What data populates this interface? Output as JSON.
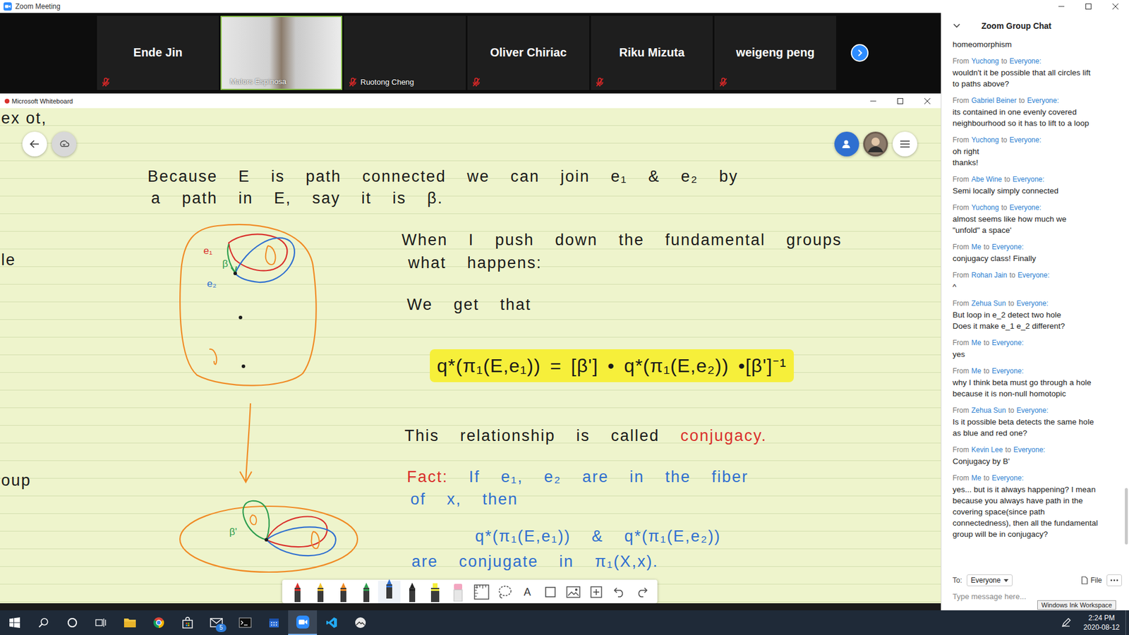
{
  "zoom": {
    "title": "Zoom Meeting"
  },
  "participants": [
    {
      "name": "Ende Jin",
      "kind": "name",
      "muted": true,
      "speaking": false
    },
    {
      "name": "Malors Espinosa",
      "kind": "video",
      "muted": false,
      "speaking": true
    },
    {
      "name": "Ruotong Cheng",
      "kind": "blank",
      "muted": true,
      "speaking": false
    },
    {
      "name": "Oliver Chiriac",
      "kind": "name",
      "muted": true,
      "speaking": false
    },
    {
      "name": "Riku Mizuta",
      "kind": "name",
      "muted": true,
      "speaking": false
    },
    {
      "name": "weigeng peng",
      "kind": "name",
      "muted": true,
      "speaking": false
    }
  ],
  "whiteboard": {
    "title": "Microsoft Whiteboard",
    "edge_fragments": [
      "ex ot,",
      "le",
      "oup"
    ],
    "notes": [
      {
        "highlighted": false,
        "spans": [
          {
            "text": "Because E is path connected we can join e₁ & e₂ by",
            "color": "#1a1a1a"
          }
        ]
      },
      {
        "highlighted": false,
        "spans": [
          {
            "text": "a path in E, say it is β.",
            "color": "#1a1a1a"
          }
        ]
      },
      {
        "highlighted": false,
        "spans": [
          {
            "text": "When I push down the fundamental groups",
            "color": "#1a1a1a"
          }
        ]
      },
      {
        "highlighted": false,
        "spans": [
          {
            "text": "what happens:",
            "color": "#1a1a1a"
          }
        ]
      },
      {
        "highlighted": false,
        "spans": [
          {
            "text": "We get that",
            "color": "#1a1a1a"
          }
        ]
      },
      {
        "highlighted": true,
        "spans": [
          {
            "text": "q*(π₁(E,e₁)) = [β'] • q*(π₁(E,e₂)) •[β']⁻¹",
            "color": "#1a1a1a"
          }
        ]
      },
      {
        "highlighted": false,
        "spans": [
          {
            "text": "This relationship is called ",
            "color": "#1a1a1a"
          },
          {
            "text": "conjugacy.",
            "color": "#d9302c"
          }
        ]
      },
      {
        "highlighted": false,
        "spans": [
          {
            "text": "Fact:",
            "color": "#d9302c"
          },
          {
            "text": " If e₁, e₂ are in the fiber",
            "color": "#2f6fd0"
          }
        ]
      },
      {
        "highlighted": false,
        "spans": [
          {
            "text": "of x, then",
            "color": "#2f6fd0"
          }
        ]
      },
      {
        "highlighted": false,
        "spans": [
          {
            "text": "q*(π₁(E,e₁)) & q*(π₁(E,e₂))",
            "color": "#2f6fd0"
          }
        ]
      },
      {
        "highlighted": false,
        "spans": [
          {
            "text": "are conjugate in π₁(X,x).",
            "color": "#2f6fd0"
          }
        ]
      }
    ],
    "diagram": {
      "labels": [
        {
          "text": "e₁",
          "color": "#d9302c"
        },
        {
          "text": "β",
          "color": "#2e9e4f"
        },
        {
          "text": "e₂",
          "color": "#2f6fd0"
        },
        {
          "text": "β'",
          "color": "#2e9e4f"
        }
      ]
    },
    "tools": [
      {
        "kind": "pen",
        "color": "#d9302c",
        "selected": false
      },
      {
        "kind": "pen",
        "color": "#f2c230",
        "selected": false
      },
      {
        "kind": "pen",
        "color": "#f08a24",
        "selected": false
      },
      {
        "kind": "pen",
        "color": "#2e9e4f",
        "selected": false
      },
      {
        "kind": "pen",
        "color": "#2f6fd0",
        "selected": true
      },
      {
        "kind": "pen",
        "color": "#222222",
        "selected": false
      },
      {
        "kind": "highlighter",
        "color": "#f6ef3a",
        "selected": false
      },
      {
        "kind": "eraser",
        "selected": false
      },
      {
        "kind": "ruler",
        "selected": false
      },
      {
        "kind": "lasso",
        "selected": false
      },
      {
        "kind": "text",
        "label": "A",
        "selected": false
      },
      {
        "kind": "shape",
        "selected": false
      },
      {
        "kind": "image",
        "selected": false
      },
      {
        "kind": "insert",
        "selected": false
      },
      {
        "kind": "undo",
        "selected": false
      },
      {
        "kind": "redo",
        "selected": false
      }
    ]
  },
  "chat": {
    "title": "Zoom Group Chat",
    "from_word": "From",
    "to_word": "to",
    "lead": [
      "homeomorphism"
    ],
    "messages": [
      {
        "sender": "Yuchong",
        "recipient": "Everyone:",
        "lines": [
          "wouldn't it be possible that all circles lift",
          "to paths above?"
        ]
      },
      {
        "sender": "Gabriel Beiner",
        "recipient": "Everyone:",
        "lines": [
          "its contained in one evenly covered",
          "neighbourhood so it has to lift to a loop"
        ]
      },
      {
        "sender": "Yuchong",
        "recipient": "Everyone:",
        "lines": [
          "oh right",
          "thanks!"
        ]
      },
      {
        "sender": "Abe Wine",
        "recipient": "Everyone:",
        "lines": [
          "Semi locally simply connected"
        ]
      },
      {
        "sender": "Yuchong",
        "recipient": "Everyone:",
        "lines": [
          "almost seems like how much we",
          "\"unfold\" a space'"
        ]
      },
      {
        "sender": "Me",
        "recipient": "Everyone:",
        "lines": [
          "conjugacy class! Finally"
        ]
      },
      {
        "sender": "Rohan Jain",
        "recipient": "Everyone:",
        "lines": [
          "^"
        ]
      },
      {
        "sender": "Zehua Sun",
        "recipient": "Everyone:",
        "lines": [
          "But loop in e_2 detect two hole",
          "Does it make e_1 e_2 different?"
        ]
      },
      {
        "sender": "Me",
        "recipient": "Everyone:",
        "lines": [
          "yes"
        ]
      },
      {
        "sender": "Me",
        "recipient": "Everyone:",
        "lines": [
          "why I think beta must go through a hole",
          "because it is non-null homotopic"
        ]
      },
      {
        "sender": "Zehua Sun",
        "recipient": "Everyone:",
        "lines": [
          "Is it possible beta detects the same hole",
          "as blue and red one?"
        ]
      },
      {
        "sender": "Kevin Lee",
        "recipient": "Everyone:",
        "lines": [
          "Conjugacy by B'"
        ]
      },
      {
        "sender": "Me",
        "recipient": "Everyone:",
        "lines": [
          "yes... but is it always happening? I mean",
          "because you always have path in the",
          "covering space(since path",
          "connectedness), then all the fundamental",
          "group will be in conjugacy?"
        ]
      }
    ],
    "to_label": "To:",
    "to_value": "Everyone",
    "file_label": "File",
    "placeholder": "Type message here..."
  },
  "taskbar": {
    "items": [
      {
        "kind": "start",
        "active": false
      },
      {
        "kind": "search",
        "active": false
      },
      {
        "kind": "cortana",
        "active": false
      },
      {
        "kind": "taskview",
        "active": false
      },
      {
        "kind": "explorer",
        "active": false
      },
      {
        "kind": "chrome",
        "active": false
      },
      {
        "kind": "store",
        "active": false
      },
      {
        "kind": "mail",
        "active": false,
        "badge": "5"
      },
      {
        "kind": "terminal",
        "active": false
      },
      {
        "kind": "calendar",
        "active": false
      },
      {
        "kind": "zoom",
        "active": true
      },
      {
        "kind": "vscode",
        "active": false
      },
      {
        "kind": "photos",
        "active": false
      }
    ],
    "time": "2:24 PM",
    "date": "2020-08-12"
  },
  "tooltip": "Windows Ink Workspace"
}
